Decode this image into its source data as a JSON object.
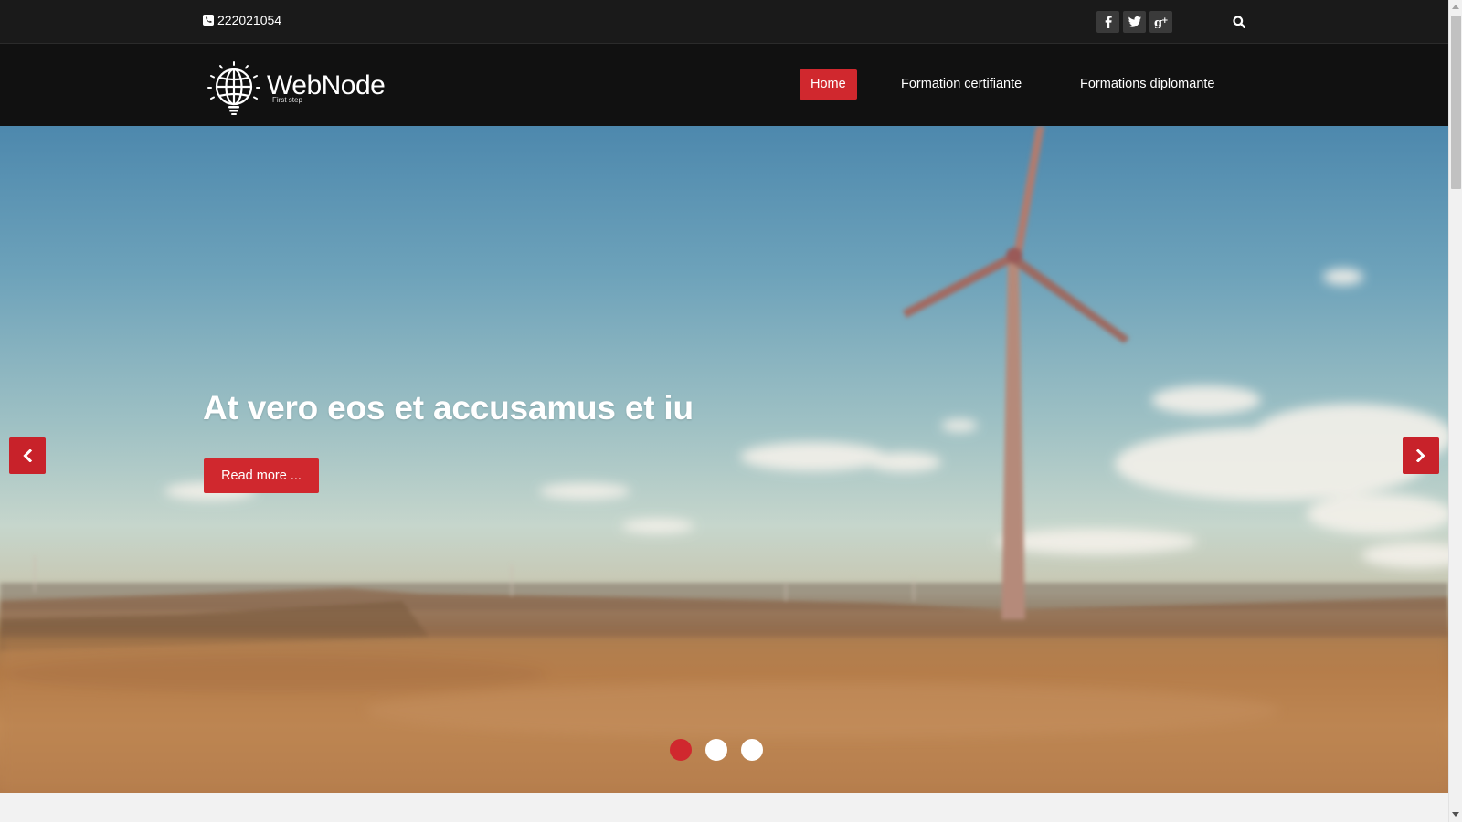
{
  "topbar": {
    "phone": "222021054",
    "socials": [
      {
        "icon": "facebook-icon",
        "glyph": "f"
      },
      {
        "icon": "twitter-icon",
        "glyph": "t"
      },
      {
        "icon": "google-plus-icon",
        "glyph": "g+"
      }
    ],
    "search_icon": "search-icon"
  },
  "header": {
    "logo_name": "WebNode",
    "logo_tagline": "First step",
    "nav": [
      {
        "label": "Home",
        "active": true
      },
      {
        "label": "Formation certifiante",
        "active": false
      },
      {
        "label": "Formations diplomante",
        "active": false
      }
    ]
  },
  "hero": {
    "title": "At vero eos et accusamus et iu",
    "button_label": "Read more ...",
    "slides_total": 3,
    "active_slide": 1
  },
  "colors": {
    "accent": "#d0282e",
    "topbar_bg": "#1a1a1a",
    "header_bg": "#111111"
  }
}
